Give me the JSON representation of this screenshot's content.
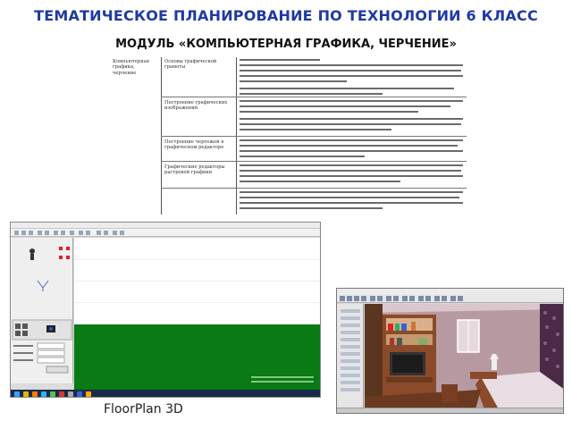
{
  "page": {
    "title": "ТЕМАТИЧЕСКОЕ ПЛАНИРОВАНИЕ ПО ТЕХНОЛОГИИ 6 КЛАСС",
    "subtitle": "МОДУЛЬ «КОМПЬЮТЕРНАЯ ГРАФИКА, ЧЕРЧЕНИЕ»",
    "caption": "FloorPlan 3D"
  },
  "document_table": {
    "col1": "Компьютерная графика, черчение",
    "rows": [
      {
        "topic": "Основы графической грамоты"
      },
      {
        "topic": "Построение графических изображений"
      },
      {
        "topic": "Построение чертежей в графическом редакторе"
      },
      {
        "topic": "Графические редакторы растровой графики"
      }
    ]
  },
  "colors": {
    "title": "#1f3aa3",
    "green_area": "#0a7a14",
    "room_wall": "#b79aa1",
    "furniture": "#8b4a2a"
  },
  "icons": {
    "shot1_toolbar": "toolbar-icons",
    "shot1_person": "person-icon",
    "shot1_camera": "camera-icon",
    "shot2_window": "window-icon"
  }
}
